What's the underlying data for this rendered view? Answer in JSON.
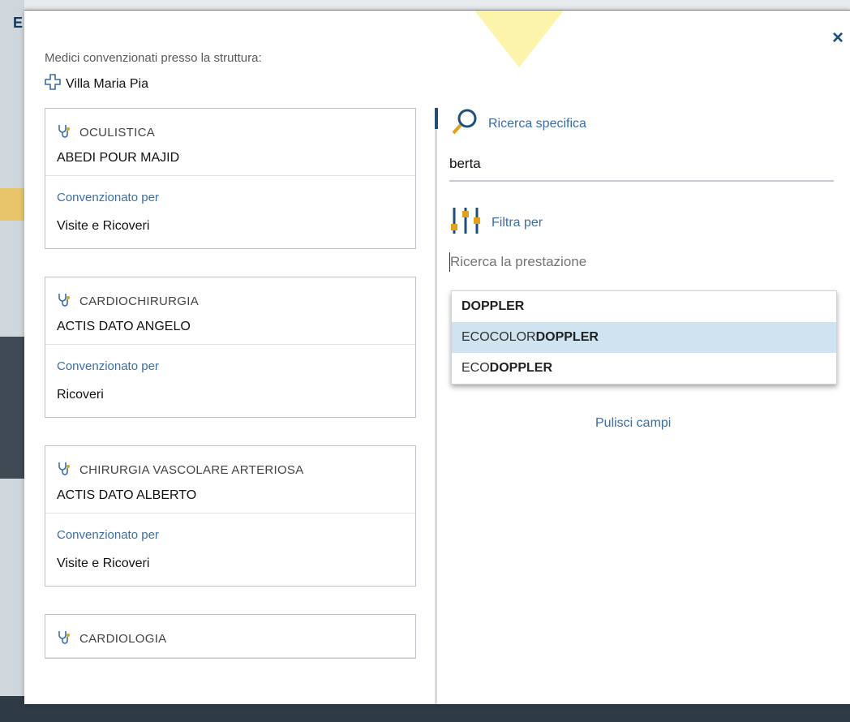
{
  "modal": {
    "intro": "Medici convenzionati presso la struttura:",
    "facility": "Villa Maria Pia",
    "close_label": "×"
  },
  "background": {
    "edge_letter": "E"
  },
  "cards": [
    {
      "specialty": "OCULISTICA",
      "doctor": "ABEDI POUR MAJID",
      "conv_label": "Convenzionato per",
      "conv_type": "Visite e Ricoveri"
    },
    {
      "specialty": "CARDIOCHIRURGIA",
      "doctor": "ACTIS DATO ANGELO",
      "conv_label": "Convenzionato per",
      "conv_type": "Ricoveri"
    },
    {
      "specialty": "CHIRURGIA VASCOLARE ARTERIOSA",
      "doctor": "ACTIS DATO ALBERTO",
      "conv_label": "Convenzionato per",
      "conv_type": "Visite e Ricoveri"
    },
    {
      "specialty": "CARDIOLOGIA"
    }
  ],
  "search": {
    "heading": "Ricerca specifica",
    "value": "berta"
  },
  "filter": {
    "heading": "Filtra per",
    "placeholder": "Ricerca la prestazione",
    "options": [
      {
        "prefix": "",
        "match": "DOPPLER"
      },
      {
        "prefix": "ECOCOLOR",
        "match": "DOPPLER"
      },
      {
        "prefix": "ECO",
        "match": "DOPPLER"
      }
    ],
    "active_index": 1
  },
  "actions": {
    "clear_label": "Pulisci campi"
  },
  "colors": {
    "accent": "#3a6ea5",
    "brand": "#1f4e79",
    "highlight": "#cfe3f0",
    "pointer": "#fbf3a5"
  },
  "icons": {
    "facility": "medical-cross-icon",
    "specialty": "stethoscope-icon",
    "search": "search-icon",
    "filter": "sliders-icon",
    "close": "close-icon"
  }
}
